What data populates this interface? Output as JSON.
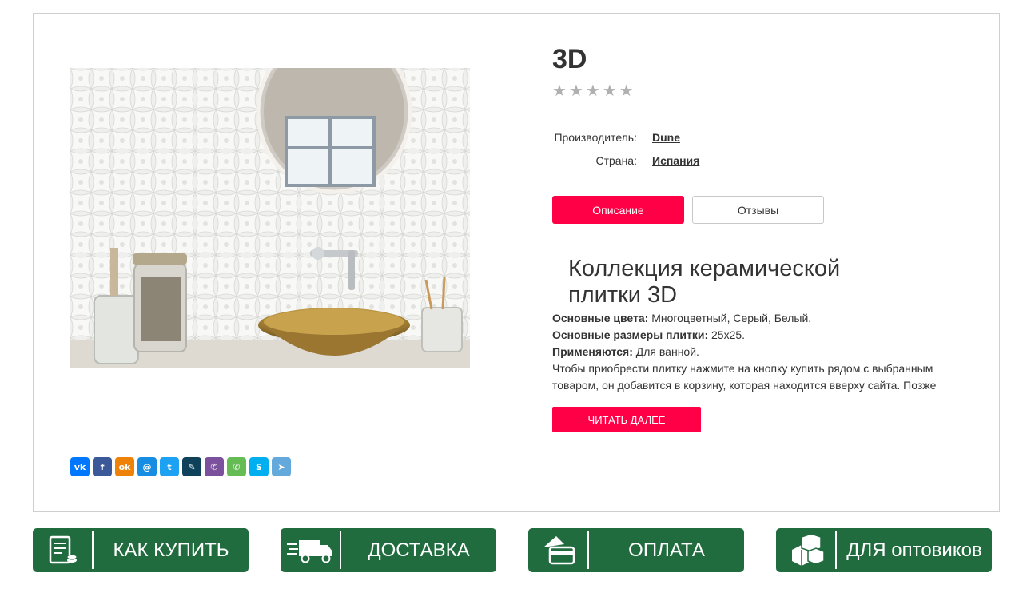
{
  "product": {
    "title": "3D",
    "rating": {
      "value": 0,
      "max": 5
    },
    "image_alt": "bathroom with white 3D tiles and gold sink"
  },
  "properties": [
    {
      "label": "Производитель:",
      "value": "Dune"
    },
    {
      "label": "Страна:",
      "value": "Испания"
    }
  ],
  "tabs": [
    {
      "label": "Описание",
      "active": true
    },
    {
      "label": "Отзывы",
      "active": false
    }
  ],
  "description": {
    "heading": "Коллекция керамической плитки 3D",
    "colors_label": "Основные цвета:",
    "colors_value": " Многоцветный, Серый, Белый.",
    "sizes_label": "Основные размеры плитки:",
    "sizes_value": " 25x25.",
    "usage_label": "Применяются:",
    "usage_value": " Для ванной.",
    "text": "Чтобы приобрести плитку нажмите на кнопку купить рядом с выбранным товаром, он добавится в корзину, которая находится вверху сайта. Позже"
  },
  "read_more": "ЧИТАТЬ ДАЛЕЕ",
  "share": [
    {
      "icon": "vk-icon",
      "glyph": "vk",
      "color": "#0077ff"
    },
    {
      "icon": "facebook-icon",
      "glyph": "f",
      "color": "#3b5998"
    },
    {
      "icon": "odnoklassniki-icon",
      "glyph": "ok",
      "color": "#ee8208"
    },
    {
      "icon": "moimir-icon",
      "glyph": "@",
      "color": "#168de2"
    },
    {
      "icon": "twitter-icon",
      "glyph": "t",
      "color": "#1da1f2"
    },
    {
      "icon": "livejournal-icon",
      "glyph": "✎",
      "color": "#0d425a"
    },
    {
      "icon": "viber-icon",
      "glyph": "✆",
      "color": "#7b519d"
    },
    {
      "icon": "whatsapp-icon",
      "glyph": "✆",
      "color": "#65bc54"
    },
    {
      "icon": "skype-icon",
      "glyph": "S",
      "color": "#00aff0"
    },
    {
      "icon": "telegram-icon",
      "glyph": "➤",
      "color": "#64a9dc"
    }
  ],
  "banners": [
    {
      "label": "КАК КУПИТЬ",
      "icon": "receipt-icon"
    },
    {
      "label": "ДОСТАВКА",
      "icon": "delivery-truck-icon"
    },
    {
      "label": "ОПЛАТА",
      "icon": "payment-card-icon"
    },
    {
      "label": "ДЛЯ оптовиков",
      "icon": "boxes-icon"
    }
  ],
  "colors": {
    "accent": "#ff0047",
    "banner": "#216c3f",
    "star": "#b0b0b0"
  }
}
